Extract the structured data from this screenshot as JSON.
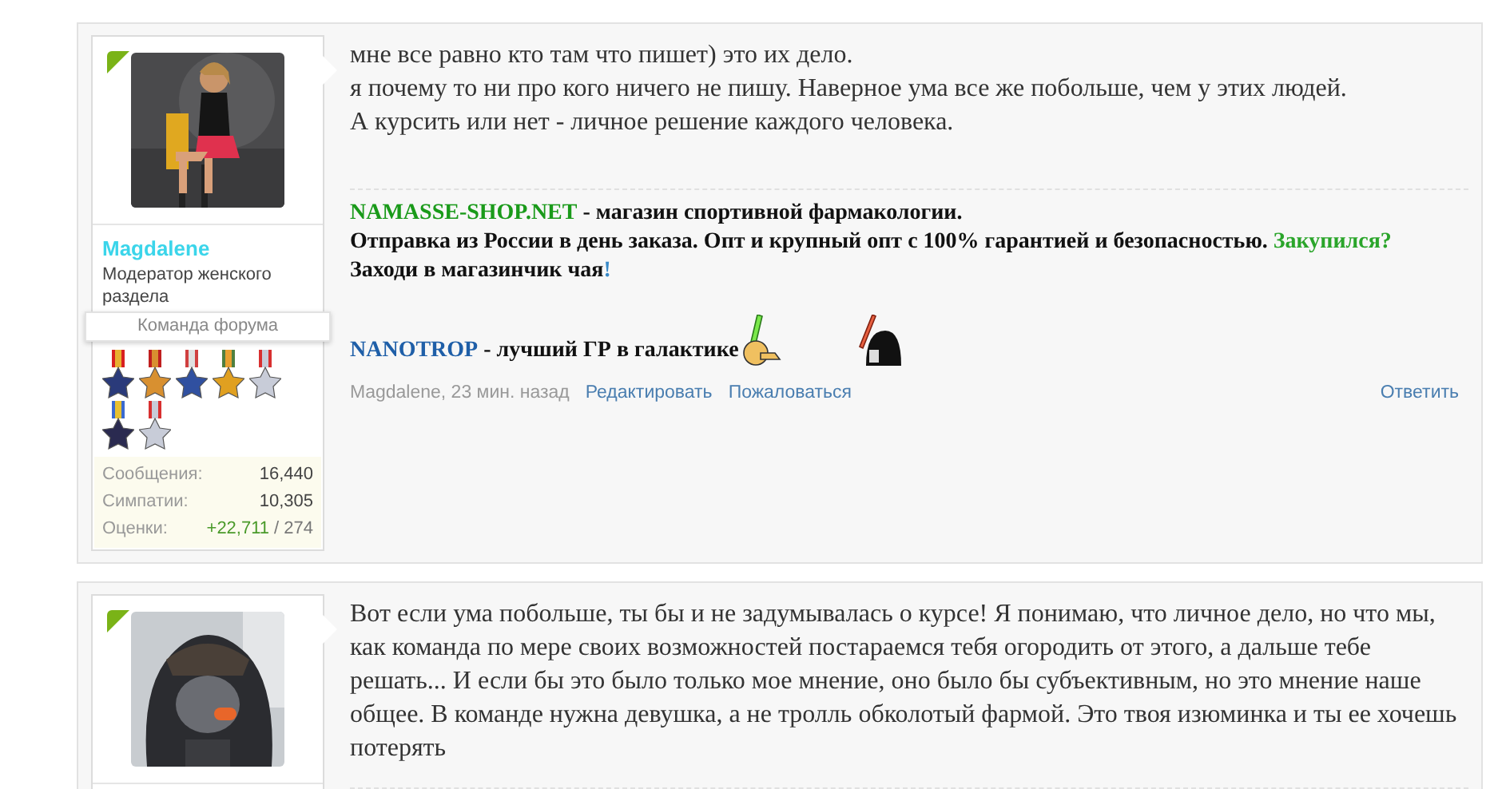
{
  "posts": [
    {
      "user": {
        "name": "Magdalene",
        "title": "Модератор женского раздела",
        "group": "Команда форума",
        "avatar": {
          "kind": "picture"
        },
        "stats": [
          {
            "label": "Сообщения:",
            "value": "16,440"
          },
          {
            "label": "Симпатии:",
            "value": "10,305"
          },
          {
            "label": "Оценки:",
            "value": "+22,711",
            "extra": "/ 274"
          }
        ]
      },
      "message": [
        "мне все равно кто там что пишет) это их дело.",
        "я почему то ни про кого ничего не пишу. Наверное ума все же побольше, чем у этих людей.",
        "А курсить или нет - личное решение каждого человека."
      ],
      "signature": [
        [
          {
            "kind": "link",
            "text": "NAMASSE-SHOP.NET",
            "color": "#1a9a1a"
          },
          {
            "kind": "text",
            "text": " - магазин спортивной фармакологии."
          }
        ],
        [
          {
            "kind": "text",
            "text": "Отправка из России в день заказа. Опт и крупный опт с 100% гарантией и безопасностью. "
          },
          {
            "kind": "link",
            "text": "Закупился?",
            "color": "#2aa52a"
          }
        ],
        [
          {
            "kind": "text",
            "text": "Заходи в магазинчик чая"
          },
          {
            "kind": "link",
            "text": "!",
            "color": "#3a8ac8"
          }
        ],
        [
          {
            "kind": "link",
            "text": "NANOTROP",
            "color": "#1f5fa8"
          },
          {
            "kind": "text",
            "text": " - лучший ГР в галактике"
          },
          {
            "kind": "smiley"
          },
          {
            "kind": "vader"
          }
        ]
      ],
      "footer": {
        "meta": "Magdalene, 23 мин. назад",
        "actions": [
          "Редактировать",
          "Пожаловаться"
        ],
        "reply": "Ответить"
      }
    },
    {
      "user": {
        "avatar": {
          "kind": "picture"
        }
      },
      "message": [
        "Вот если ума побольше, ты бы и не задумывалась о курсе! Я понимаю, что личное дело, но что мы, как команда по мере своих возможностей постараемся тебя огородить от этого, а дальше тебе решать... И если бы это было только мое мнение, оно было бы субъективным, но это мнение наше общее. В команде нужна девушка, а не тролль обколотый фармой. Это твоя изюминка и ты ее хочешь потерять"
      ]
    }
  ]
}
